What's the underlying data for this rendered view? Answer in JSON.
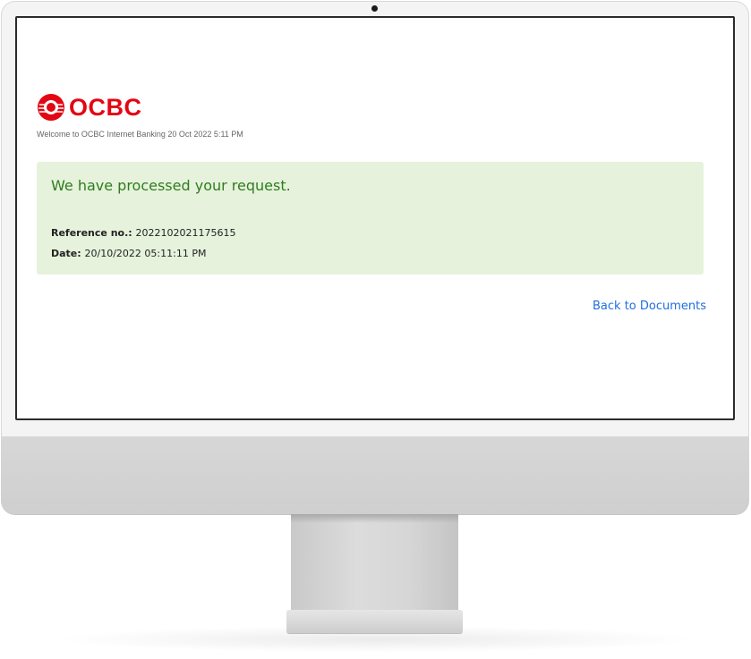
{
  "brand": {
    "name": "OCBC",
    "color": "#e30613"
  },
  "header": {
    "welcome_text": "Welcome to OCBC Internet Banking 20 Oct 2022 5:11 PM"
  },
  "confirmation": {
    "title": "We have processed your request.",
    "reference_label": "Reference no.:",
    "reference_value": "2022102021175615",
    "date_label": "Date:",
    "date_value": "20/10/2022 05:11:11 PM",
    "panel_color": "#e6f2dc",
    "title_color": "#2e7d1d"
  },
  "actions": {
    "back_label": "Back to Documents",
    "link_color": "#1f6fe0"
  }
}
